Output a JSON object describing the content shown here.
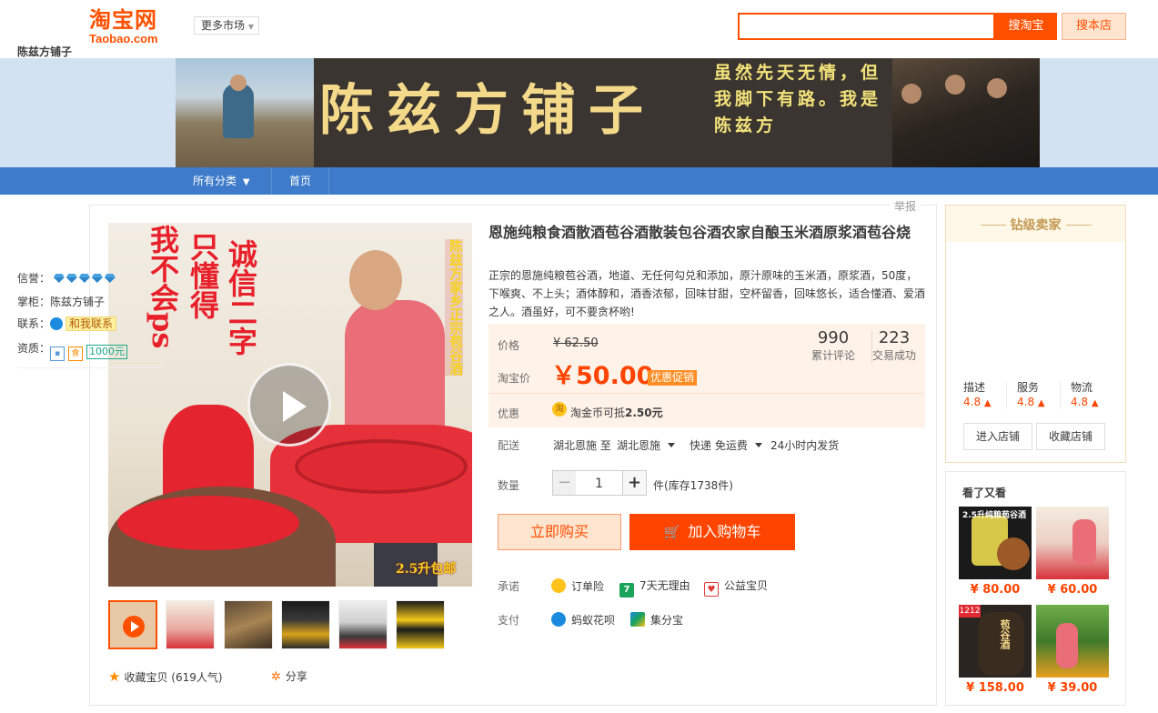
{
  "header": {
    "logo_cn": "淘宝网",
    "logo_en": "Taobao.com",
    "more_market": "更多市场",
    "search_button": "搜淘宝",
    "search_shop_button": "搜本店"
  },
  "banner": {
    "shop_title": "陈兹方铺子",
    "slogan": "虽然先天无情，但我脚下有路。我是陈兹方"
  },
  "nav": {
    "all_categories": "所有分类",
    "home": "首页"
  },
  "report": "举报",
  "product": {
    "title": "恩施纯粮食酒散酒苞谷酒散装包谷酒农家自酿玉米酒原浆酒苞谷烧",
    "subtitle": "正宗的恩施纯粮苞谷酒，地道、无任何勾兑和添加，原汁原味的玉米酒，原浆酒，50度，下喉爽、不上头；酒体醇和，酒香浓郁，回味甘甜，空杯留香，回味悠长，适合懂酒、爱酒之人。酒虽好，可不要贪杯哟!",
    "image_text": {
      "left_col1": "我不会ps",
      "left_col2": "只懂得",
      "left_col3": "诚信二字",
      "right_col": "陈兹方家乡正宗苞谷酒",
      "baoyou": "2.5升包邮"
    },
    "price_label": "价格",
    "original_price": "¥ 62.50",
    "taobao_price_label": "淘宝价",
    "price": "￥50.00",
    "promo_tag": "优惠促销",
    "reviews_count": "990",
    "reviews_label": "累计评论",
    "sales_count": "223",
    "sales_label": "交易成功",
    "discount_label": "优惠",
    "coin_icon": "淘",
    "coin_text_prefix": "淘金币可抵",
    "coin_amount": "2.50元",
    "shipping_label": "配送",
    "ship_from": "湖北恩施 至",
    "ship_to": "湖北恩施",
    "ship_method": "快递 免运费",
    "ship_time": "24小时内发货",
    "quantity_label": "数量",
    "quantity_minus": "−",
    "quantity": "1",
    "quantity_plus": "+",
    "stock": "件(库存1738件)",
    "buy_now": "立即购买",
    "add_to_cart": "加入购物车",
    "promise_label": "承诺",
    "promises": [
      "订单险",
      "7天无理由",
      "公益宝贝"
    ],
    "seven_day_icon": "7",
    "pay_label": "支付",
    "payments": [
      "蚂蚁花呗",
      "集分宝"
    ],
    "collect": "收藏宝贝",
    "collect_count": "(619人气)",
    "share": "分享"
  },
  "seller": {
    "rank_title": "钻级卖家",
    "shop_name": "陈兹方铺子",
    "credit_label": "信誉：",
    "keeper_label": "掌柜：",
    "keeper_name": "陈兹方铺子",
    "contact_label": "联系：",
    "contact_button": "和我联系",
    "qualification_label": "资质：",
    "qualification_icon": "食",
    "deposit": "1000元",
    "scores": [
      {
        "label": "描述",
        "value": "4.8"
      },
      {
        "label": "服务",
        "value": "4.8"
      },
      {
        "label": "物流",
        "value": "4.8"
      }
    ],
    "enter_shop": "进入店铺",
    "favorite_shop": "收藏店铺"
  },
  "recommendations": {
    "title": "看了又看",
    "items": [
      {
        "price": "¥ 80.00"
      },
      {
        "price": "¥ 60.00"
      },
      {
        "price": "¥ 158.00"
      },
      {
        "price": "¥ 39.00"
      }
    ],
    "labels": {
      "rec1": "2.5升纯粮苞谷酒",
      "rec3_tag": "1212",
      "rec3_jar": "苞谷酒"
    }
  },
  "colors": {
    "accent": "#ff5000",
    "price": "#ff4400",
    "nav": "#3e7bca",
    "banner_bg": "#d2e2f3"
  },
  "icons": [
    "search-icon",
    "play-icon",
    "star-icon",
    "share-icon",
    "cart-icon",
    "coin-icon",
    "diamond-icon",
    "contact-icon",
    "arrow-up-icon"
  ]
}
